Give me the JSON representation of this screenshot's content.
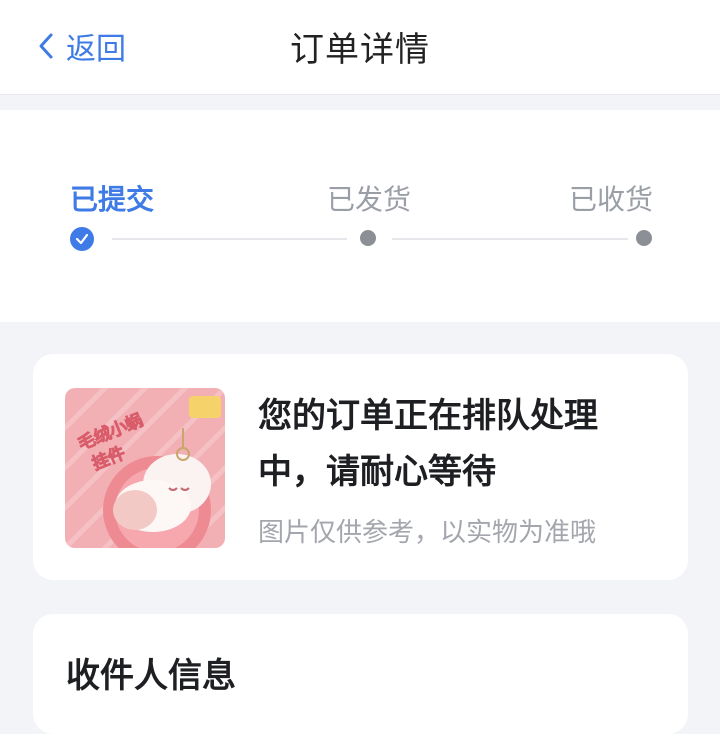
{
  "header": {
    "back_label": "返回",
    "title": "订单详情"
  },
  "progress": {
    "steps": [
      {
        "label": "已提交",
        "state": "done"
      },
      {
        "label": "已发货",
        "state": "pending"
      },
      {
        "label": "已收货",
        "state": "pending"
      }
    ]
  },
  "order_status": {
    "message": "您的订单正在排队处理中，请耐心等待",
    "image_note": "图片仅供参考，以实物为准哦",
    "product_image_text": "毛绒小蜗挂件"
  },
  "receiver": {
    "title": "收件人信息"
  },
  "colors": {
    "accent": "#3f7be6",
    "bg": "#f2f4f7",
    "muted": "#9a9ea6"
  }
}
